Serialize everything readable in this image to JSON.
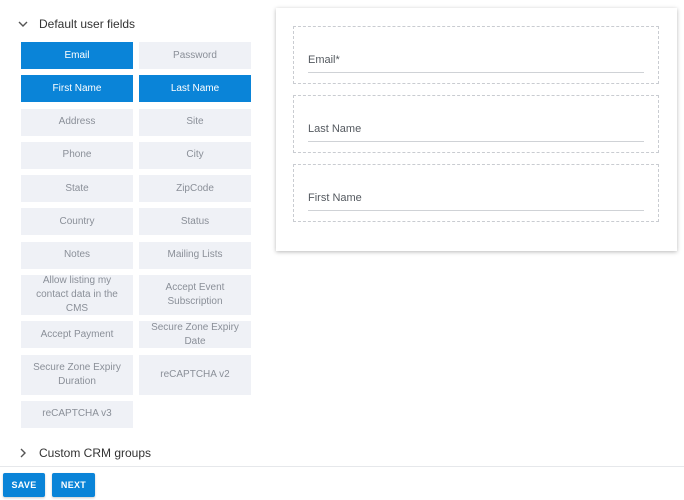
{
  "sections": {
    "default_fields": {
      "label": "Default user fields",
      "expanded": true
    },
    "custom_crm": {
      "label": "Custom CRM groups",
      "expanded": false
    }
  },
  "fields": [
    {
      "label": "Email",
      "active": true
    },
    {
      "label": "Password",
      "active": false
    },
    {
      "label": "First Name",
      "active": true
    },
    {
      "label": "Last Name",
      "active": true
    },
    {
      "label": "Address",
      "active": false
    },
    {
      "label": "Site",
      "active": false
    },
    {
      "label": "Phone",
      "active": false
    },
    {
      "label": "City",
      "active": false
    },
    {
      "label": "State",
      "active": false
    },
    {
      "label": "ZipCode",
      "active": false
    },
    {
      "label": "Country",
      "active": false
    },
    {
      "label": "Status",
      "active": false
    },
    {
      "label": "Notes",
      "active": false
    },
    {
      "label": "Mailing Lists",
      "active": false
    },
    {
      "label": "Allow listing my contact data in the CMS",
      "active": false
    },
    {
      "label": "Accept Event Subscription",
      "active": false
    },
    {
      "label": "Accept Payment",
      "active": false
    },
    {
      "label": "Secure Zone Expiry Date",
      "active": false
    },
    {
      "label": "Secure Zone Expiry Duration",
      "active": false
    },
    {
      "label": "reCAPTCHA v2",
      "active": false
    },
    {
      "label": "reCAPTCHA v3",
      "active": false
    }
  ],
  "form_preview": {
    "fields": [
      {
        "label": "Email*"
      },
      {
        "label": "Last Name"
      },
      {
        "label": "First Name"
      }
    ]
  },
  "actions": {
    "save_label": "SAVE",
    "next_label": "NEXT"
  },
  "colors": {
    "accent": "#0a84d8",
    "inactive_bg": "#eff1f6",
    "inactive_text": "#8a8f98"
  }
}
